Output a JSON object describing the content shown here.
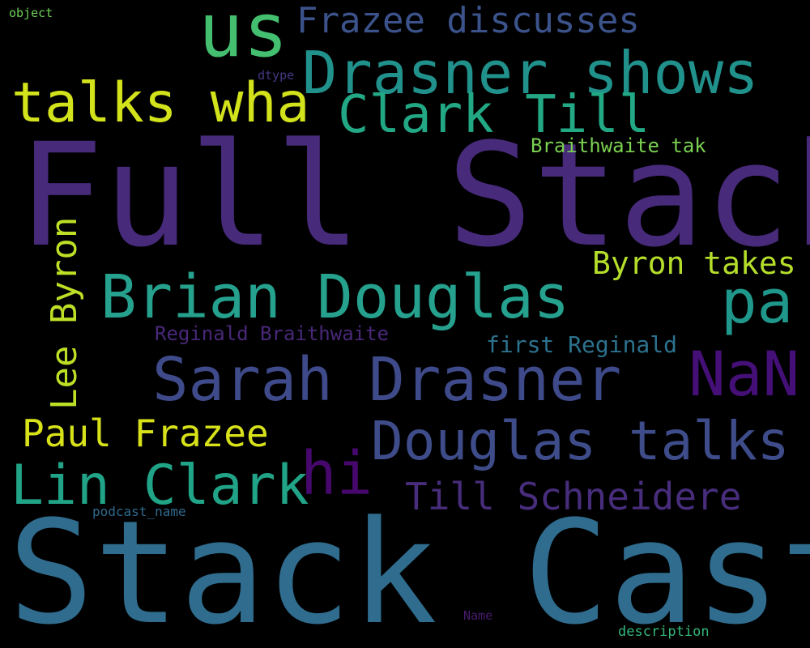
{
  "words": {
    "full_stack": {
      "text": "Full Stack",
      "color": "#472a7a"
    },
    "stack_cast": {
      "text": "Stack Cast",
      "color": "#2f6c8e"
    },
    "us": {
      "text": "us",
      "color": "#44bf70"
    },
    "frazee_discusses": {
      "text": "Frazee discusses",
      "color": "#3b528b"
    },
    "drasner_shows": {
      "text": "Drasner shows",
      "color": "#21918c"
    },
    "talks_wha": {
      "text": "talks wha",
      "color": "#d2e21b"
    },
    "clark_till": {
      "text": "Clark Till",
      "color": "#22a884"
    },
    "braithwaite_tak": {
      "text": "Braithwaite tak",
      "color": "#7ad151"
    },
    "brian_douglas": {
      "text": "Brian Douglas",
      "color": "#25a18e"
    },
    "pa": {
      "text": "pa",
      "color": "#1f988b"
    },
    "byron_takes": {
      "text": "Byron takes",
      "color": "#b5de2b"
    },
    "lee_byron": {
      "text": "Lee Byron",
      "color": "#bddf26"
    },
    "reginald_braithwaite": {
      "text": "Reginald Braithwaite",
      "color": "#482878"
    },
    "first_reginald": {
      "text": "first Reginald",
      "color": "#2c728e"
    },
    "sarah_drasner": {
      "text": "Sarah Drasner",
      "color": "#3e4a89"
    },
    "nan": {
      "text": "NaN",
      "color": "#440f76"
    },
    "paul_frazee": {
      "text": "Paul Frazee",
      "color": "#d8e219"
    },
    "douglas_talks": {
      "text": "Douglas talks",
      "color": "#3e4c8a"
    },
    "hi": {
      "text": "hi",
      "color": "#46086c"
    },
    "lin_clark": {
      "text": "Lin Clark",
      "color": "#20a386"
    },
    "till_schneidere": {
      "text": "Till Schneidere",
      "color": "#472d7b"
    },
    "podcast_name": {
      "text": "podcast_name",
      "color": "#30698e"
    },
    "dtype": {
      "text": "dtype",
      "color": "#443983"
    },
    "object": {
      "text": "object",
      "color": "#6ece58"
    },
    "name": {
      "text": "Name",
      "color": "#481b6d"
    },
    "description": {
      "text": "description",
      "color": "#35b779"
    }
  }
}
